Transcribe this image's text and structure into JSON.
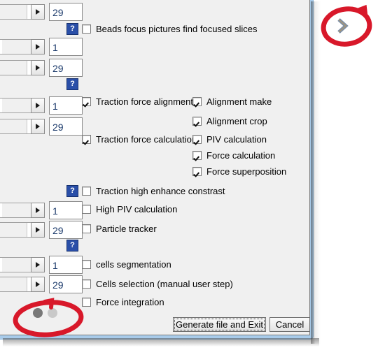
{
  "dialog": {
    "title": "",
    "background_color": "#f0f0f0",
    "frame_color": "#a8cbea"
  },
  "spinners": [
    {
      "name": "spinner-row-1",
      "value": "29"
    },
    {
      "name": "spinner-row-2",
      "value": "1"
    },
    {
      "name": "spinner-row-3",
      "value": "29"
    },
    {
      "name": "spinner-row-4",
      "value": "1"
    },
    {
      "name": "spinner-row-5",
      "value": "29"
    },
    {
      "name": "spinner-row-6",
      "value": "1"
    },
    {
      "name": "spinner-row-7",
      "value": "29"
    },
    {
      "name": "spinner-row-8",
      "value": "1"
    },
    {
      "name": "spinner-row-9",
      "value": "29"
    }
  ],
  "help_buttons": [
    {
      "name": "help-beads",
      "label": "?"
    },
    {
      "name": "help-traction",
      "label": "?"
    },
    {
      "name": "help-contrast",
      "label": "?"
    },
    {
      "name": "help-cells",
      "label": "?"
    }
  ],
  "checkboxes": {
    "beads_focus": {
      "label": "Beads focus pictures find focused slices",
      "checked": false
    },
    "traction_force_alignment": {
      "label": "Traction force alignment",
      "checked": true
    },
    "alignment_make": {
      "label": "Alignment make",
      "checked": true
    },
    "alignment_crop": {
      "label": "Alignment crop",
      "checked": true
    },
    "traction_force_calculation": {
      "label": "Traction force calculation",
      "checked": true
    },
    "piv_calculation": {
      "label": "PIV    calculation",
      "checked": true
    },
    "force_calculation": {
      "label": "Force calculation",
      "checked": true
    },
    "force_superposition": {
      "label": "Force superposition",
      "checked": true
    },
    "traction_high_enhance_constrast": {
      "label": "Traction high enhance constrast",
      "checked": false
    },
    "high_piv_calculation": {
      "label": "High PIV calculation",
      "checked": false
    },
    "particle_tracker": {
      "label": "Particle tracker",
      "checked": false
    },
    "cells_segmentation": {
      "label": "cells segmentation",
      "checked": false
    },
    "cells_selection": {
      "label": "Cells selection (manual user step)",
      "checked": false
    },
    "force_integration": {
      "label": "Force integration",
      "checked": false
    }
  },
  "footer": {
    "generate_button": "Generate file and Exit",
    "cancel_button": "Cancel",
    "page_dots": [
      {
        "name": "page-dot-1",
        "state": "active"
      },
      {
        "name": "page-dot-2",
        "state": "inactive"
      }
    ]
  },
  "nav": {
    "next_arrow": "›"
  },
  "annotations": {
    "color": "#d8182a",
    "items": [
      {
        "name": "annotation-circle-next-arrow",
        "target": "next-arrow"
      },
      {
        "name": "annotation-circle-page-dots",
        "target": "page-dots"
      }
    ]
  }
}
